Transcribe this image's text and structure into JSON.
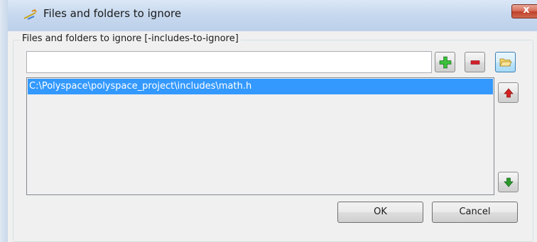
{
  "window": {
    "title": "Files and folders to ignore",
    "close_symbol": "x"
  },
  "group": {
    "label": "Files and folders to ignore [-includes-to-ignore]"
  },
  "path_input": {
    "value": "",
    "placeholder": ""
  },
  "toolbar": {
    "add_icon": "green-plus-icon",
    "remove_icon": "red-minus-icon",
    "browse_icon": "folder-open-icon"
  },
  "list": {
    "items": [
      {
        "label": "C:\\Polyspace\\polyspace_project\\includes\\math.h",
        "selected": true
      }
    ]
  },
  "side_buttons": {
    "move_up_icon": "red-up-arrow-icon",
    "move_down_icon": "green-down-arrow-icon"
  },
  "footer": {
    "ok_label": "OK",
    "cancel_label": "Cancel"
  },
  "colors": {
    "selection": "#3399ff",
    "add": "#2fa82f",
    "remove": "#d21f2b",
    "up_arrow": "#d42020",
    "down_arrow": "#2b9a2b"
  }
}
